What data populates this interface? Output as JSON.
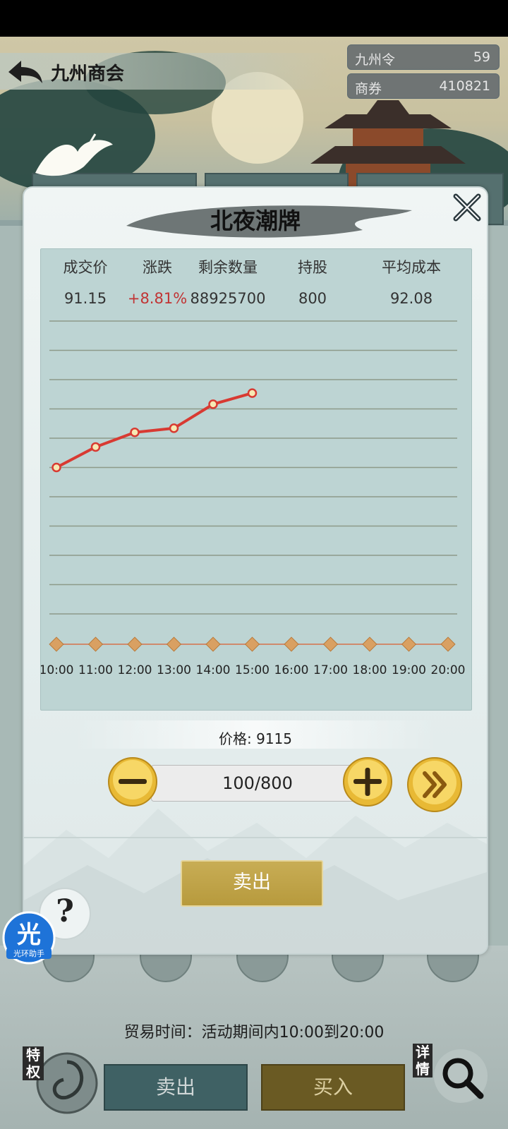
{
  "header": {
    "title": "九州商会",
    "currencies": [
      {
        "label": "九州令",
        "value": "59"
      },
      {
        "label": "商券",
        "value": "410821"
      }
    ]
  },
  "modal": {
    "title": "北夜潮牌",
    "stats_headers": [
      "成交价",
      "涨跌",
      "剩余数量",
      "持股",
      "平均成本"
    ],
    "stats_values": [
      "91.15",
      "+8.81%",
      "88925700",
      "800",
      "92.08"
    ],
    "price_label": "价格: 9115",
    "quantity": "100/800",
    "sell_label": "卖出"
  },
  "chart_data": {
    "type": "line",
    "x": [
      "10:00",
      "11:00",
      "12:00",
      "13:00",
      "14:00",
      "15:00",
      "16:00",
      "17:00",
      "18:00",
      "19:00",
      "20:00"
    ],
    "series": [
      {
        "values": [
          82.5,
          86.0,
          88.5,
          89.2,
          93.3,
          95.2,
          null,
          null,
          null,
          null,
          null
        ]
      }
    ],
    "ylim": [
      57.5,
      107.5
    ],
    "grid": true,
    "colors": {
      "line": "#d83a32",
      "marker_fill": "#f7e9b3",
      "axis_marker": "#d9a062"
    }
  },
  "footer": {
    "trade_time": "贸易时间：活动期间内10:00到20:00",
    "sell_label": "卖出",
    "buy_label": "买入",
    "privilege_label": "特权",
    "detail_label": "详情"
  },
  "assistant": {
    "label": "光环助手",
    "glyph": "光"
  },
  "help": {
    "glyph": "?"
  }
}
